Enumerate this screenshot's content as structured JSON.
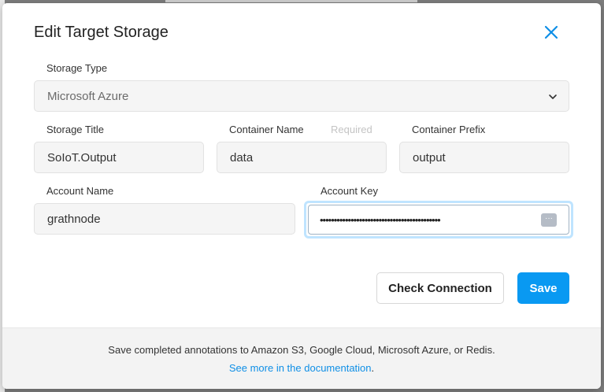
{
  "dialog": {
    "title": "Edit Target Storage",
    "close_icon": "close-icon"
  },
  "form": {
    "storage_type": {
      "label": "Storage Type",
      "value": "Microsoft Azure",
      "icon": "chevron-down-icon"
    },
    "storage_title": {
      "label": "Storage Title",
      "value": "SoIoT.Output"
    },
    "container_name": {
      "label": "Container Name",
      "hint": "Required",
      "value": "data"
    },
    "container_prefix": {
      "label": "Container Prefix",
      "value": "output"
    },
    "account_name": {
      "label": "Account Name",
      "value": "grathnode"
    },
    "account_key": {
      "label": "Account Key",
      "value": "•••••••••••••••••••••••••••••••••••••••••••",
      "icon": "password-manager-icon"
    }
  },
  "buttons": {
    "check_connection": "Check Connection",
    "save": "Save"
  },
  "footer": {
    "text": "Save completed annotations to Amazon S3, Google Cloud, Microsoft Azure, or Redis.",
    "link": "See more in the documentation",
    "link_suffix": "."
  },
  "colors": {
    "primary": "#0999f2",
    "link": "#0f8fe6",
    "focus_ring": "#bfe4ff"
  }
}
